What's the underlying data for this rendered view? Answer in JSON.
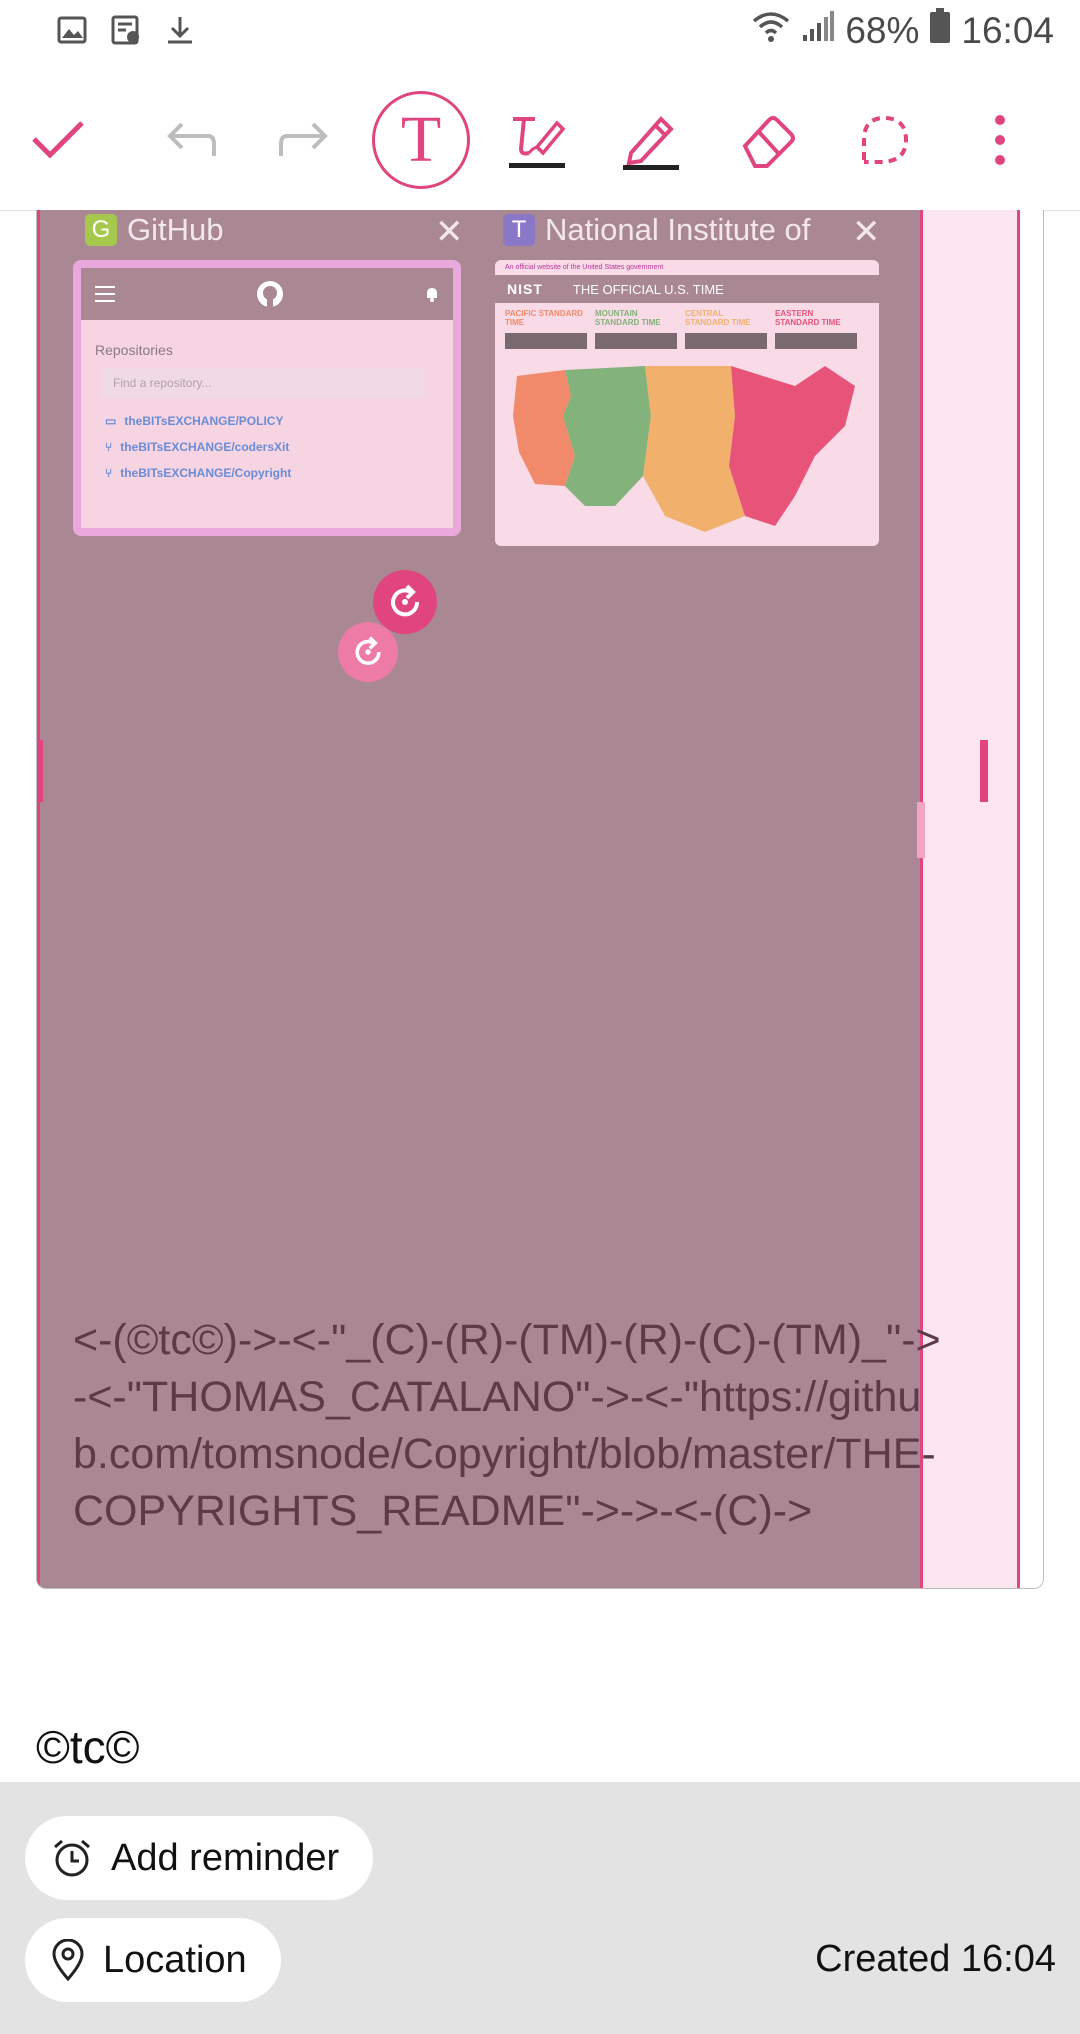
{
  "status_bar": {
    "battery": "68%",
    "time": "16:04"
  },
  "toolbar": {
    "colors": {
      "accent": "#e0457f"
    },
    "text_tool_label": "T"
  },
  "note": {
    "tabs": [
      {
        "favicon": "G",
        "title": "GitHub",
        "favicon_color": "#a6c84c"
      },
      {
        "favicon": "T",
        "title": "National Institute of",
        "favicon_color": "#8a77c7"
      }
    ],
    "github": {
      "section": "Repositories",
      "search_placeholder": "Find a repository...",
      "repos": [
        "theBITsEXCHANGE/POLICY",
        "theBITsEXCHANGE/codersXit",
        "theBITsEXCHANGE/Copyright"
      ]
    },
    "nist": {
      "top_line": "An official website of the United States government",
      "logo": "NIST",
      "title": "THE OFFICIAL U.S. TIME",
      "zones": [
        {
          "name": "PACIFIC STANDARD TIME",
          "color": "#f08a6b"
        },
        {
          "name": "MOUNTAIN STANDARD TIME",
          "color": "#83b27a"
        },
        {
          "name": "CENTRAL STANDARD TIME",
          "color": "#f2b06d"
        },
        {
          "name": "EASTERN STANDARD TIME",
          "color": "#e8537a"
        }
      ]
    },
    "body_text": "<-(©tc©)->-<-\"_(C)-(R)-(TM)-(R)-(C)-(TM)_\"->-<-\"THOMAS_CATALANO\"->-<-\"https://github.com/tomsnode/Copyright/blob/master/THE-COPYRIGHTS_README\"->->-<-(C)->",
    "signature": "©tc©"
  },
  "bottom_panel": {
    "reminder_label": "Add reminder",
    "location_label": "Location",
    "created": "Created 16:04"
  }
}
